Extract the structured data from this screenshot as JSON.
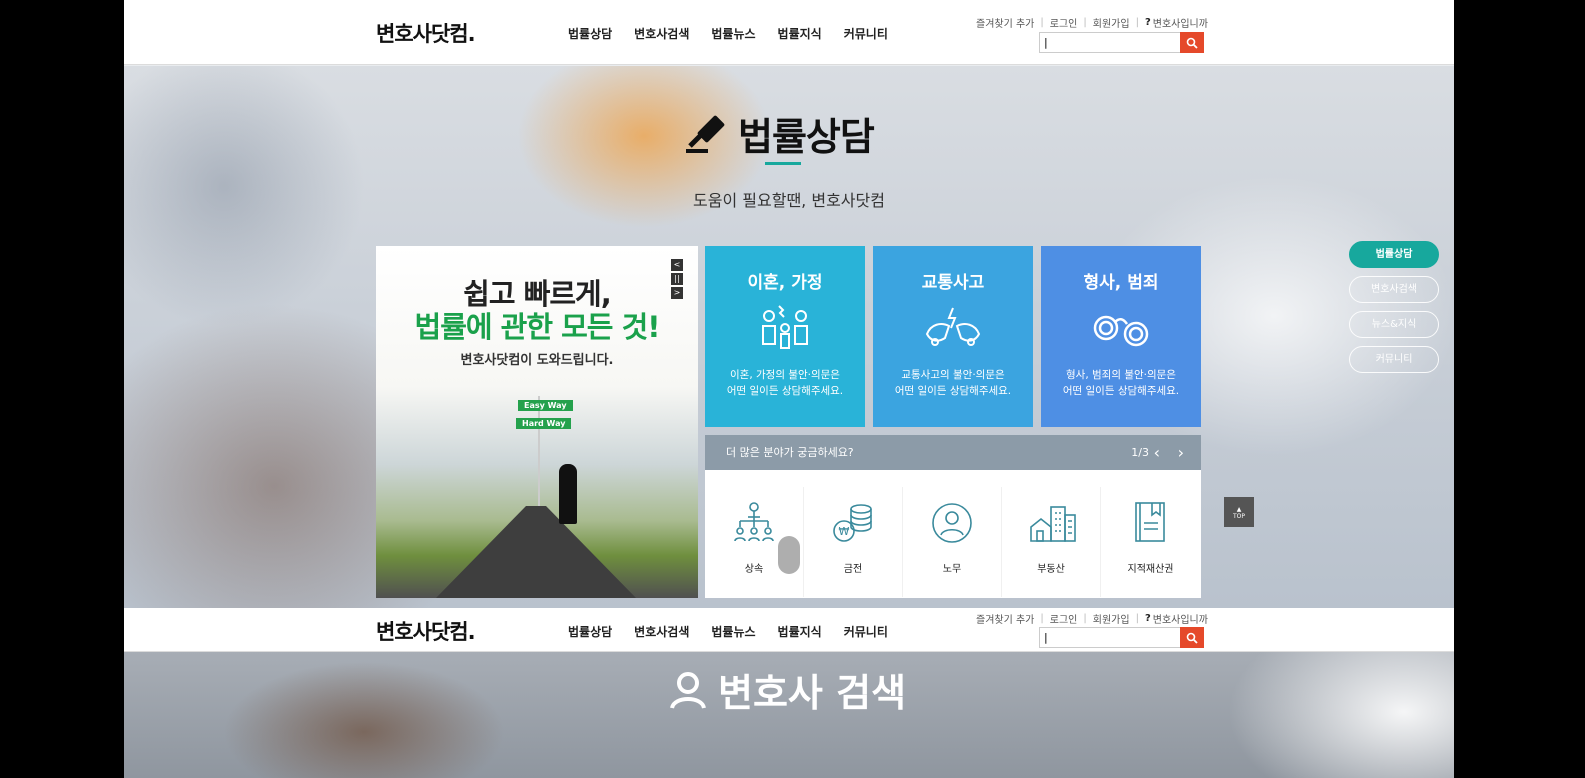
{
  "header": {
    "logo": "변호사닷컴.",
    "nav": [
      "법률상담",
      "변호사검색",
      "법률뉴스",
      "법률지식",
      "커뮤니티"
    ],
    "util": {
      "bookmark": "즐겨찾기 추가",
      "login": "로그인",
      "signup": "회원가입",
      "lawyer": "변호사입니까"
    },
    "search_value": "|"
  },
  "hero": {
    "title": "법률상담",
    "subtitle": "도움이 필요할땐, 변호사닷컴"
  },
  "banner": {
    "line1": "쉽고 빠르게,",
    "line2": "법률에 관한 모든 것!",
    "line3": "변호사닷컴이 도와드립니다.",
    "sign1": "Easy Way",
    "sign2": "Hard Way",
    "controls": [
      "<",
      "||",
      ">"
    ]
  },
  "cards": [
    {
      "title": "이혼, 가정",
      "desc1": "이혼, 가정의 불안·의문은",
      "desc2": "어떤 일이든 상담해주세요.",
      "icon": "family-icon"
    },
    {
      "title": "교통사고",
      "desc1": "교통사고의 불안·의문은",
      "desc2": "어떤 일이든 상담해주세요.",
      "icon": "car-crash-icon"
    },
    {
      "title": "형사, 범죄",
      "desc1": "형사, 범죄의 불안·의문은",
      "desc2": "어떤 일이든 상담해주세요.",
      "icon": "handcuffs-icon"
    }
  ],
  "more": {
    "title": "더 많은 분야가 궁금하세요?",
    "page": "1/3",
    "items": [
      {
        "label": "상속",
        "icon": "inheritance-icon"
      },
      {
        "label": "금전",
        "icon": "money-icon"
      },
      {
        "label": "노무",
        "icon": "labor-icon"
      },
      {
        "label": "부동산",
        "icon": "real-estate-icon"
      },
      {
        "label": "지적재산권",
        "icon": "ip-icon"
      }
    ]
  },
  "float_nav": [
    "법률상담",
    "변호사검색",
    "뉴스&지식",
    "커뮤니티"
  ],
  "top_label": "TOP",
  "hero2": {
    "title": "변호사 검색"
  },
  "colors": {
    "accent": "#17a89d",
    "search_btn": "#e5492a",
    "card1": "#29b3d8",
    "card2": "#3ba4e0",
    "card3": "#4e8fe4"
  }
}
